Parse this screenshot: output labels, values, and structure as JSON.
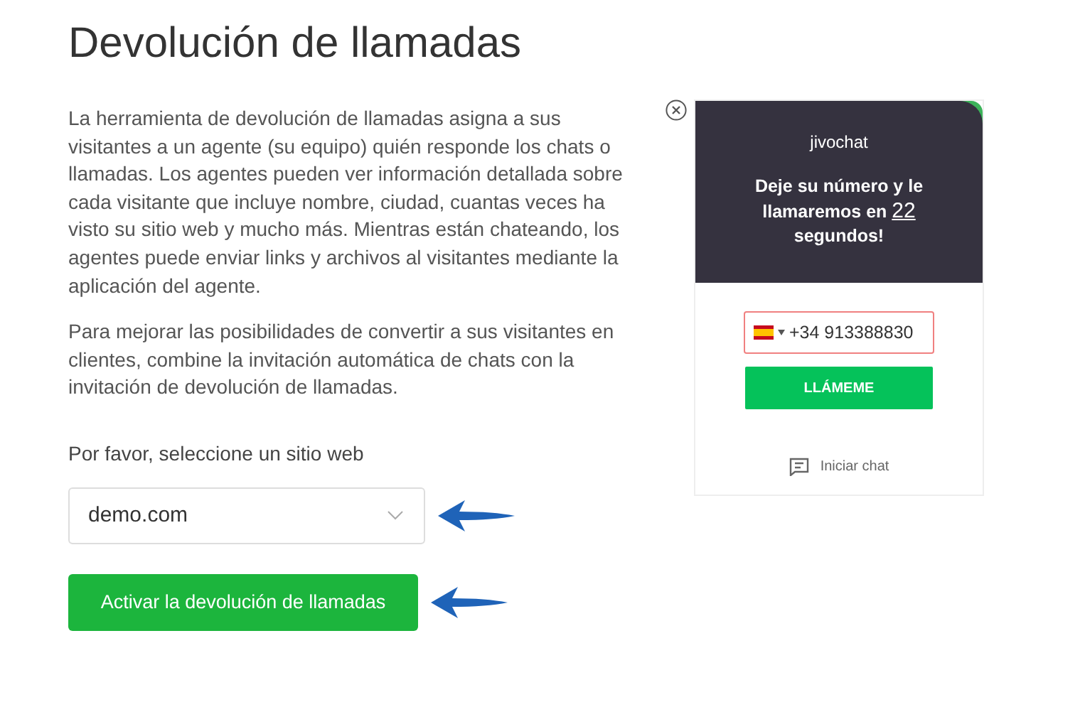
{
  "title": "Devolución de llamadas",
  "paragraphs": [
    "La herramienta de devolución de llamadas asigna a sus visitantes a un agente (su equipo) quién responde los chats o llamadas. Los agentes pueden ver información detallada sobre cada visitante que incluye nombre, ciudad, cuantas veces ha visto su sitio web y mucho más. Mientras están chateando, los agentes puede enviar links y archivos al visitantes mediante la aplicación del agente.",
    "Para mejorar las posibilidades de convertir a sus visitantes en clientes, combine la invitación automática de chats con la invitación de devolución de llamadas."
  ],
  "site_label": "Por favor, seleccione un sitio web",
  "site_select": {
    "value": "demo.com"
  },
  "activate_button": "Activar la devolución de llamadas",
  "widget": {
    "brand": "jivochat",
    "message": "Deje su número y le llamaremos en **22** segundos!",
    "phone": {
      "value": "+34 913388830"
    },
    "call_button": "LLÁMEME",
    "chat_link": "Iniciar chat"
  }
}
